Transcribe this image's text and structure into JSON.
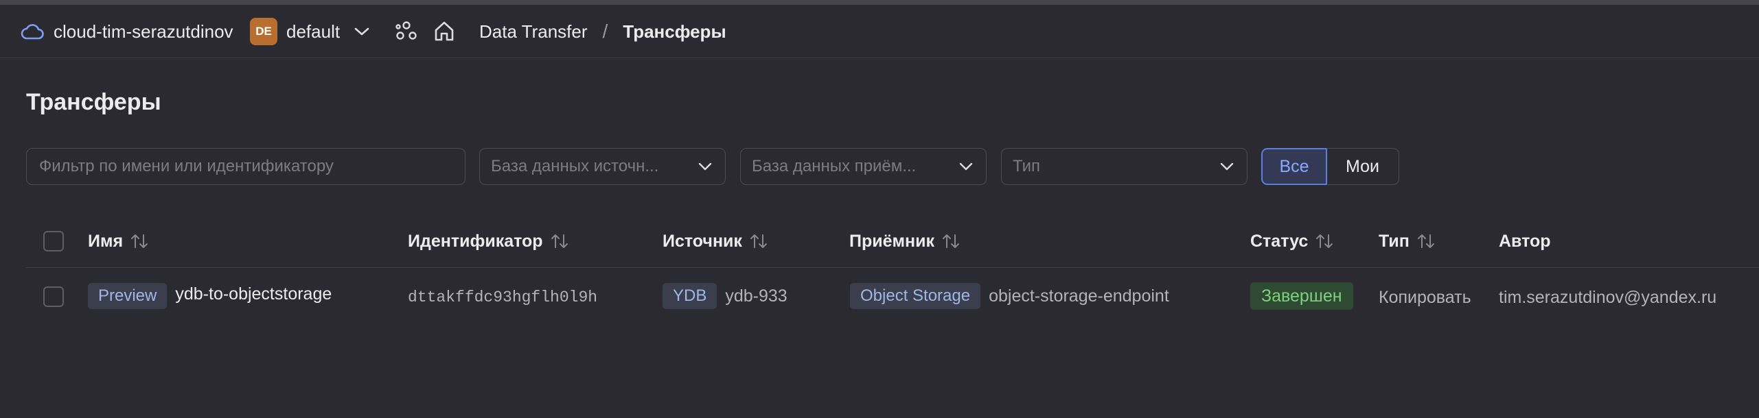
{
  "header": {
    "cloud_name": "cloud-tim-serazutdinov",
    "folder_badge": "DE",
    "folder_name": "default",
    "breadcrumb": [
      "Data Transfer",
      "Трансферы"
    ],
    "breadcrumb_separator": "/"
  },
  "page": {
    "title": "Трансферы"
  },
  "filters": {
    "search_placeholder": "Фильтр по имени или идентификатору",
    "source_db_placeholder": "База данных источн...",
    "target_db_placeholder": "База данных приём...",
    "type_placeholder": "Тип",
    "segment": {
      "all": "Все",
      "mine": "Мои",
      "selected": "Все"
    }
  },
  "table": {
    "columns": [
      "Имя",
      "Идентификатор",
      "Источник",
      "Приёмник",
      "Статус",
      "Тип",
      "Автор"
    ],
    "rows": [
      {
        "preview_tag": "Preview",
        "name": "ydb-to-objectstorage",
        "id": "dttakffdc93hgflh0l9h",
        "source_type": "YDB",
        "source_name": "ydb-933",
        "target_type": "Object Storage",
        "target_name": "object-storage-endpoint",
        "status": "Завершен",
        "type": "Копировать",
        "author": "tim.serazutdinov@yandex.ru"
      }
    ]
  },
  "colors": {
    "accent": "#5b7fe0",
    "status_done_bg": "#2f4a33",
    "status_done_text": "#7ed17c",
    "folder_badge": "#b76e2f"
  },
  "icons": [
    "cloud-icon",
    "chevron-down-icon",
    "services-icon",
    "home-icon",
    "sort-icon"
  ]
}
